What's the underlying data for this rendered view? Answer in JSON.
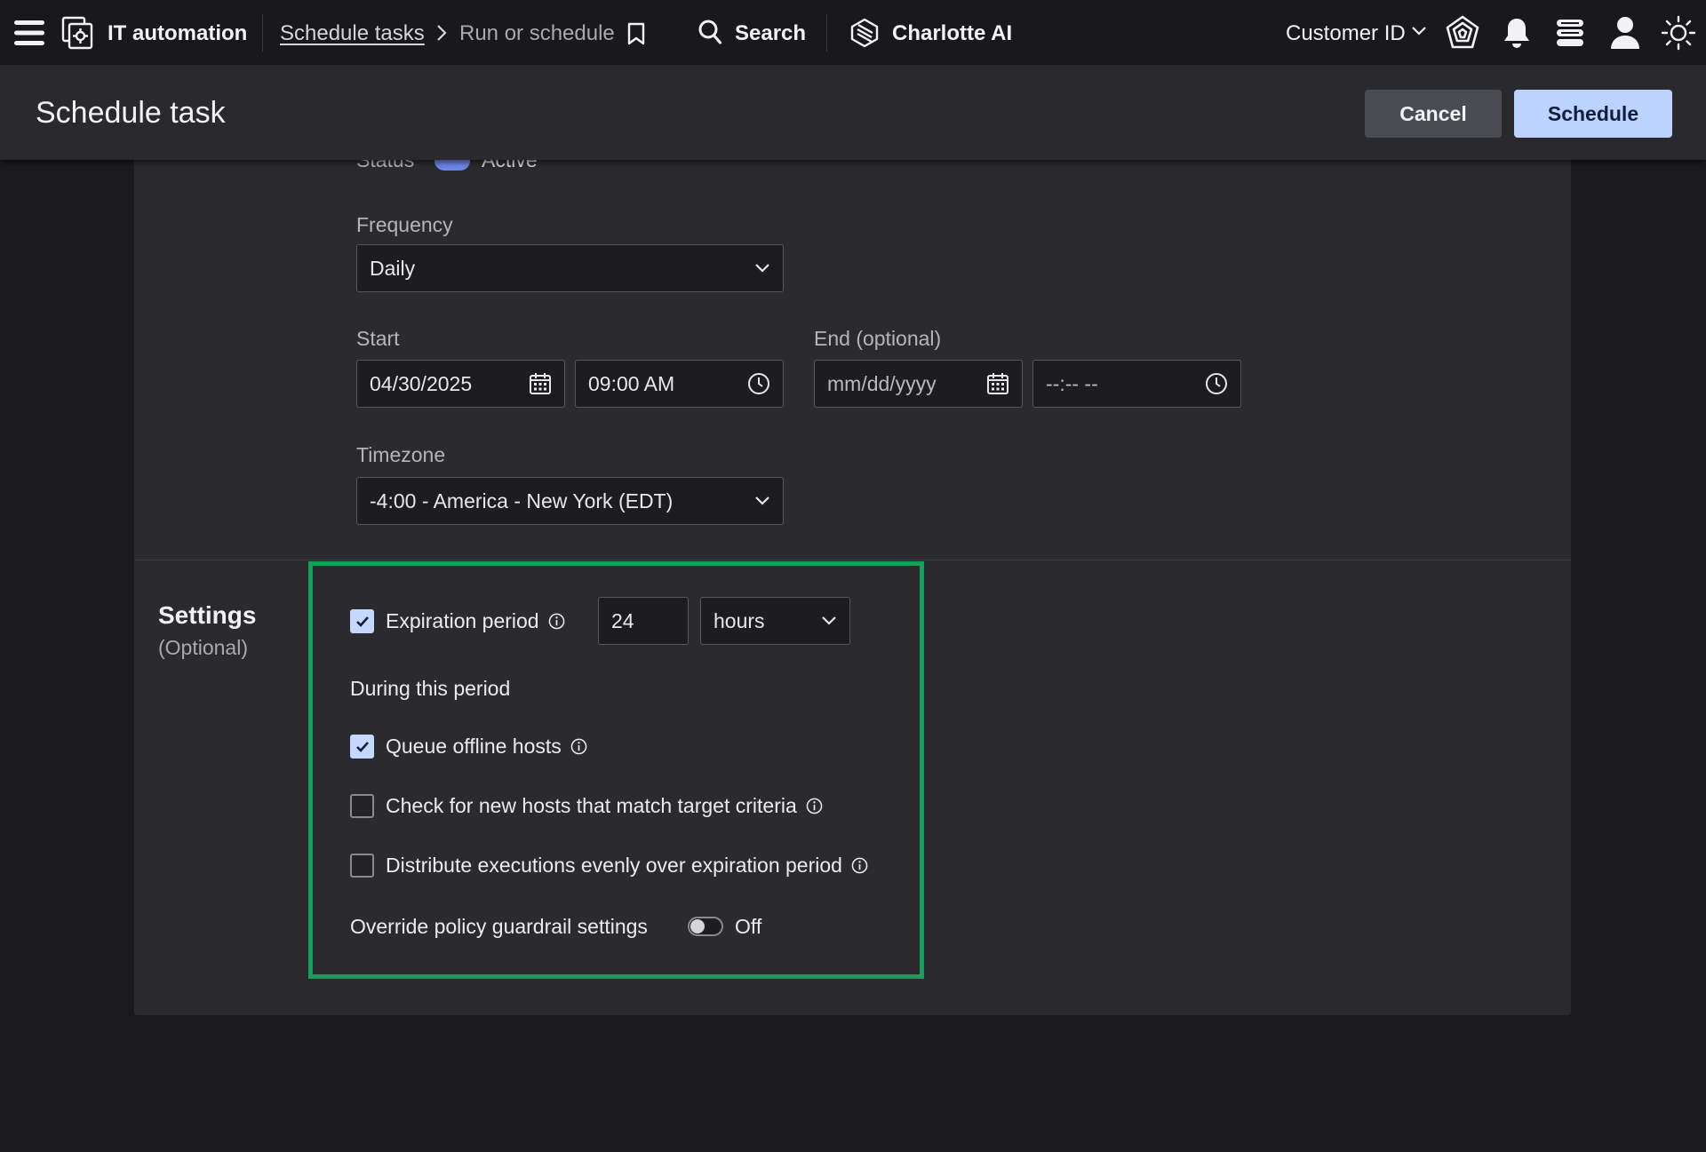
{
  "topbar": {
    "app_name": "IT automation",
    "breadcrumb_parent": "Schedule tasks",
    "breadcrumb_current": "Run or schedule",
    "search_label": "Search",
    "assistant_label": "Charlotte AI",
    "customer_id_label": "Customer ID"
  },
  "header": {
    "title": "Schedule task",
    "cancel_label": "Cancel",
    "schedule_label": "Schedule"
  },
  "schedule": {
    "status_label": "Status",
    "status_value": "Active",
    "frequency_label": "Frequency",
    "frequency_value": "Daily",
    "start_label": "Start",
    "start_date": "04/30/2025",
    "start_time": "09:00 AM",
    "end_label": "End (optional)",
    "end_date_placeholder": "mm/dd/yyyy",
    "end_time_placeholder": "--:-- --",
    "timezone_label": "Timezone",
    "timezone_value": "-4:00 - America - New York (EDT)"
  },
  "settings": {
    "title": "Settings",
    "subtitle": "(Optional)",
    "expiration_label": "Expiration period",
    "expiration_checked": true,
    "expiration_value": "24",
    "expiration_unit": "hours",
    "period_heading": "During this period",
    "queue_offline_label": "Queue offline hosts",
    "queue_offline_checked": true,
    "check_new_hosts_label": "Check for new hosts that match target criteria",
    "check_new_hosts_checked": false,
    "distribute_label": "Distribute executions evenly over expiration period",
    "distribute_checked": false,
    "override_label": "Override policy guardrail settings",
    "override_state": "Off"
  },
  "colors": {
    "highlight_border": "#14a05a",
    "primary_button": "#bcd3ff",
    "checkbox_on": "#c4d7ff"
  }
}
